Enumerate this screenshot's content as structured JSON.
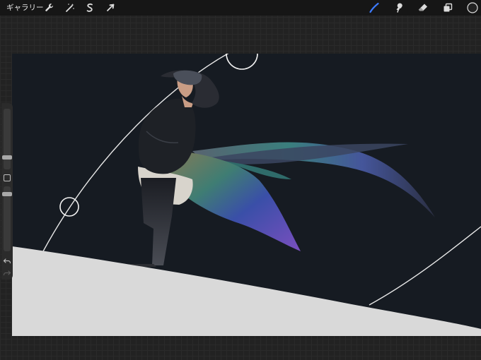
{
  "topbar": {
    "gallery_label": "ギャラリー",
    "left_tools": [
      {
        "name": "actions",
        "icon": "wrench-icon"
      },
      {
        "name": "adjustments",
        "icon": "magic-wand-icon"
      },
      {
        "name": "selection",
        "icon": "selection-s-icon"
      },
      {
        "name": "transform",
        "icon": "arrow-cursor-icon"
      }
    ],
    "right_tools": [
      {
        "name": "brush",
        "icon": "brush-icon",
        "active": true
      },
      {
        "name": "smudge",
        "icon": "smudge-icon"
      },
      {
        "name": "eraser",
        "icon": "eraser-icon"
      },
      {
        "name": "layers",
        "icon": "layers-icon"
      },
      {
        "name": "color",
        "icon": "color-swatch-icon"
      }
    ]
  },
  "colors": {
    "accent": "#3d7bff",
    "canvas_bg": "#161b22",
    "ground": "#d9d9d9",
    "current_color": "#222222"
  },
  "sidebar": {
    "brush_size_label": "brush size",
    "opacity_label": "opacity",
    "modify_label": "modify",
    "undo_icon": "undo-icon",
    "redo_icon": "redo-icon"
  }
}
